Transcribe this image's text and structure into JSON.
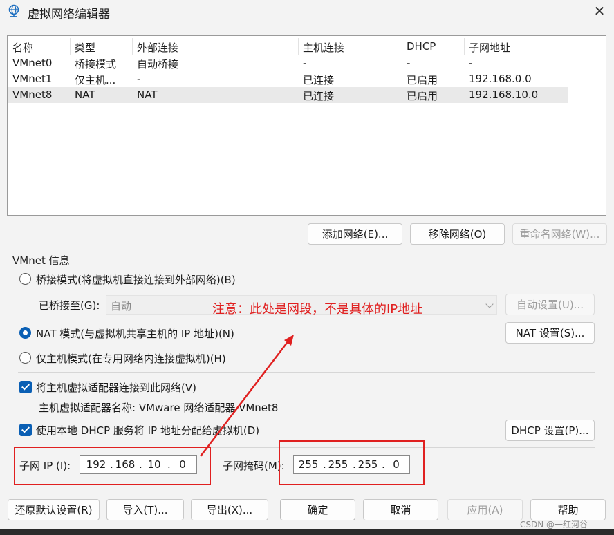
{
  "window": {
    "title": "虚拟网络编辑器"
  },
  "table": {
    "headers": [
      "名称",
      "类型",
      "外部连接",
      "主机连接",
      "DHCP",
      "子网地址"
    ],
    "rows": [
      [
        "VMnet0",
        "桥接模式",
        "自动桥接",
        "-",
        "-",
        "-"
      ],
      [
        "VMnet1",
        "仅主机...",
        "-",
        "已连接",
        "已启用",
        "192.168.0.0"
      ],
      [
        "VMnet8",
        "NAT",
        "NAT",
        "已连接",
        "已启用",
        "192.168.10.0"
      ]
    ],
    "selected_row": 2
  },
  "list_buttons": {
    "add": "添加网络(E)...",
    "remove": "移除网络(O)",
    "rename": "重命名网络(W)..."
  },
  "vmnet_info": {
    "group_label": "VMnet 信息",
    "bridged_label": "桥接模式(将虚拟机直接连接到外部网络)(B)",
    "bridged_to_label": "已桥接至(G):",
    "bridged_to_value": "自动",
    "auto_settings": "自动设置(U)...",
    "nat_label": "NAT 模式(与虚拟机共享主机的 IP 地址)(N)",
    "nat_settings": "NAT 设置(S)...",
    "hostonly_label": "仅主机模式(在专用网络内连接虚拟机)(H)",
    "connect_adapter_label": "将主机虚拟适配器连接到此网络(V)",
    "adapter_name_label": "主机虚拟适配器名称: VMware 网络适配器 VMnet8",
    "dhcp_label": "使用本地 DHCP 服务将 IP 地址分配给虚拟机(D)",
    "dhcp_settings": "DHCP 设置(P)...",
    "subnet_ip_label": "子网 IP (I):",
    "subnet_ip": [
      "192",
      "168",
      "10",
      "0"
    ],
    "subnet_mask_label": "子网掩码(M):",
    "subnet_mask": [
      "255",
      "255",
      "255",
      "0"
    ]
  },
  "annotation": "注意：此处是网段，不是具体的IP地址",
  "bottom_buttons": {
    "restore": "还原默认设置(R)",
    "import": "导入(T)...",
    "export": "导出(X)...",
    "ok": "确定",
    "cancel": "取消",
    "apply": "应用(A)",
    "help": "帮助"
  },
  "watermark": "CSDN @一红河谷",
  "colors": {
    "accent": "#0a5fb4",
    "annotation_red": "#e02020"
  },
  "icons": {
    "title": "globe-network-icon",
    "close": "close-icon"
  }
}
